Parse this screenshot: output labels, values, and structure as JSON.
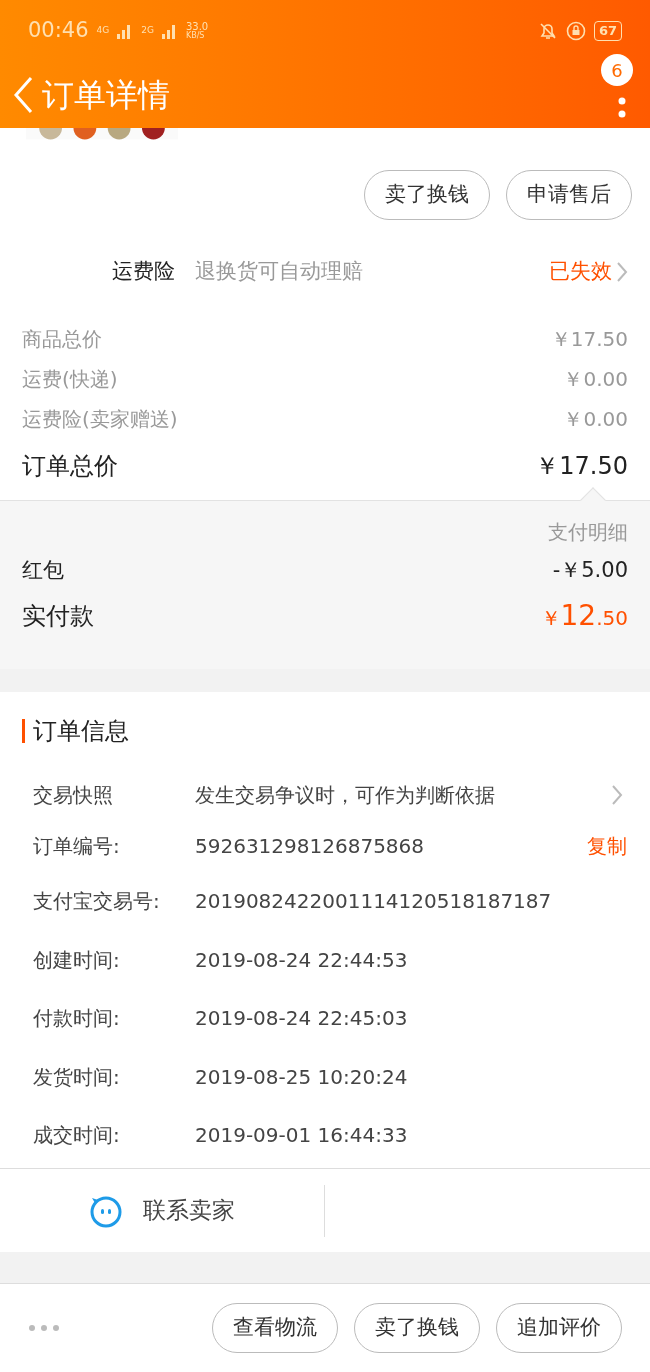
{
  "status_bar": {
    "time": "00:46",
    "network_1": "4G",
    "network_2": "2G",
    "speed": "33.0",
    "speed_unit": "KB/S",
    "battery": "67"
  },
  "header": {
    "title": "订单详情",
    "badge": "6"
  },
  "top_actions": [
    "卖了换钱",
    "申请售后"
  ],
  "insurance": {
    "label": "运费险",
    "description": "退换货可自动理赔",
    "status": "已失效"
  },
  "price_rows": [
    {
      "label": "商品总价",
      "value": "￥17.50",
      "kind": "minor"
    },
    {
      "label": "运费(快递)",
      "value": "￥0.00",
      "kind": "minor"
    },
    {
      "label": "运费险(卖家赠送)",
      "value": "￥0.00",
      "kind": "minor"
    },
    {
      "label": "订单总价",
      "value": "￥17.50",
      "kind": "major"
    }
  ],
  "payment": {
    "detail_link": "支付明细",
    "discount_label": "红包",
    "discount_value": "-￥5.00",
    "paid_label": "实付款",
    "paid_symbol": "￥",
    "paid_integer": "12",
    "paid_decimal": ".50"
  },
  "order_info": {
    "title": "订单信息",
    "rows": [
      {
        "label": "交易快照",
        "value": "发生交易争议时，可作为判断依据",
        "kind": "link"
      },
      {
        "label": "订单编号:",
        "value": "592631298126875868",
        "kind": "copy",
        "action": "复制"
      },
      {
        "label": "支付宝交易号:",
        "value": "2019082422001114120518187187",
        "kind": "plain"
      },
      {
        "label": "创建时间:",
        "value": "2019-08-24 22:44:53",
        "kind": "plain"
      },
      {
        "label": "付款时间:",
        "value": "2019-08-24 22:45:03",
        "kind": "plain"
      },
      {
        "label": "发货时间:",
        "value": "2019-08-25 10:20:24",
        "kind": "plain"
      },
      {
        "label": "成交时间:",
        "value": "2019-09-01 16:44:33",
        "kind": "plain"
      }
    ]
  },
  "contact": {
    "label": "联系卖家"
  },
  "bottom_actions": [
    "查看物流",
    "卖了换钱",
    "追加评价"
  ]
}
